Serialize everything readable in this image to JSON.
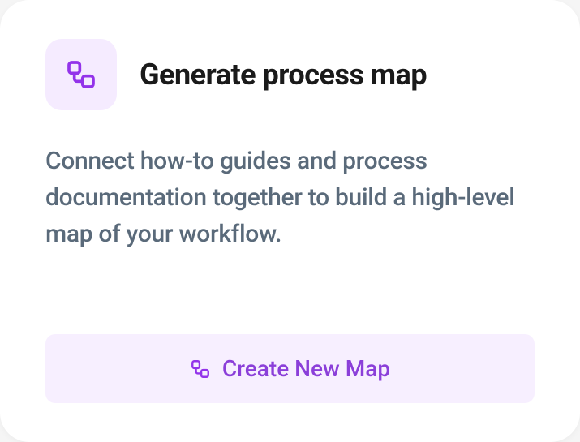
{
  "card": {
    "title": "Generate process map",
    "description": "Connect how-to guides and process documentation together to build a high-level map of your workflow.",
    "button_label": "Create New Map"
  },
  "colors": {
    "accent": "#9333ea",
    "icon_bg": "#f5ebff",
    "button_bg": "#f7efff",
    "button_text": "#8b3fd9",
    "text_primary": "#1a1a1a",
    "text_secondary": "#5a6a7a"
  }
}
